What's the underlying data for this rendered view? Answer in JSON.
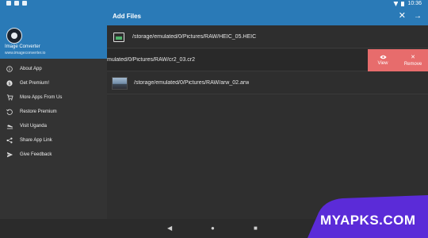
{
  "status_bar": {
    "time": "10:36"
  },
  "drawer": {
    "app_name": "Image Converter",
    "app_site": "www.imageconverter.io",
    "menu": [
      {
        "label": "About App",
        "icon": "info-icon"
      },
      {
        "label": "Get Premium!",
        "icon": "dollar-icon"
      },
      {
        "label": "More Apps From Us",
        "icon": "cart-icon"
      },
      {
        "label": "Restore Premium",
        "icon": "restore-icon"
      },
      {
        "label": "Visit Uganda",
        "icon": "plane-icon"
      },
      {
        "label": "Share App Link",
        "icon": "share-icon"
      },
      {
        "label": "Give Feedback",
        "icon": "send-icon"
      }
    ]
  },
  "appbar": {
    "title": "Add Files",
    "close_icon": "close-icon",
    "next_icon": "arrow-forward-icon"
  },
  "files": [
    {
      "path": "/storage/emulated/0/Pictures/RAW/HEIC_05.HEIC",
      "thumb": "image-file-icon"
    },
    {
      "path": "mulated/0/Pictures/RAW/cr2_03.cr2",
      "thumb": "none"
    },
    {
      "path": "/storage/emulated/0/Pictures/RAW/arw_02.arw",
      "thumb": "photo-thumbnail"
    }
  ],
  "swipe_actions": {
    "view_label": "View",
    "remove_label": "Remove",
    "color": "#e76c6c"
  },
  "nav": {
    "back": "back-icon",
    "home": "home-icon",
    "recents": "recents-icon"
  },
  "watermark": {
    "text": "MYAPKS.COM",
    "color": "#5b2bd8"
  },
  "colors": {
    "primary": "#2a7ab7",
    "background": "#2f2f2f"
  }
}
